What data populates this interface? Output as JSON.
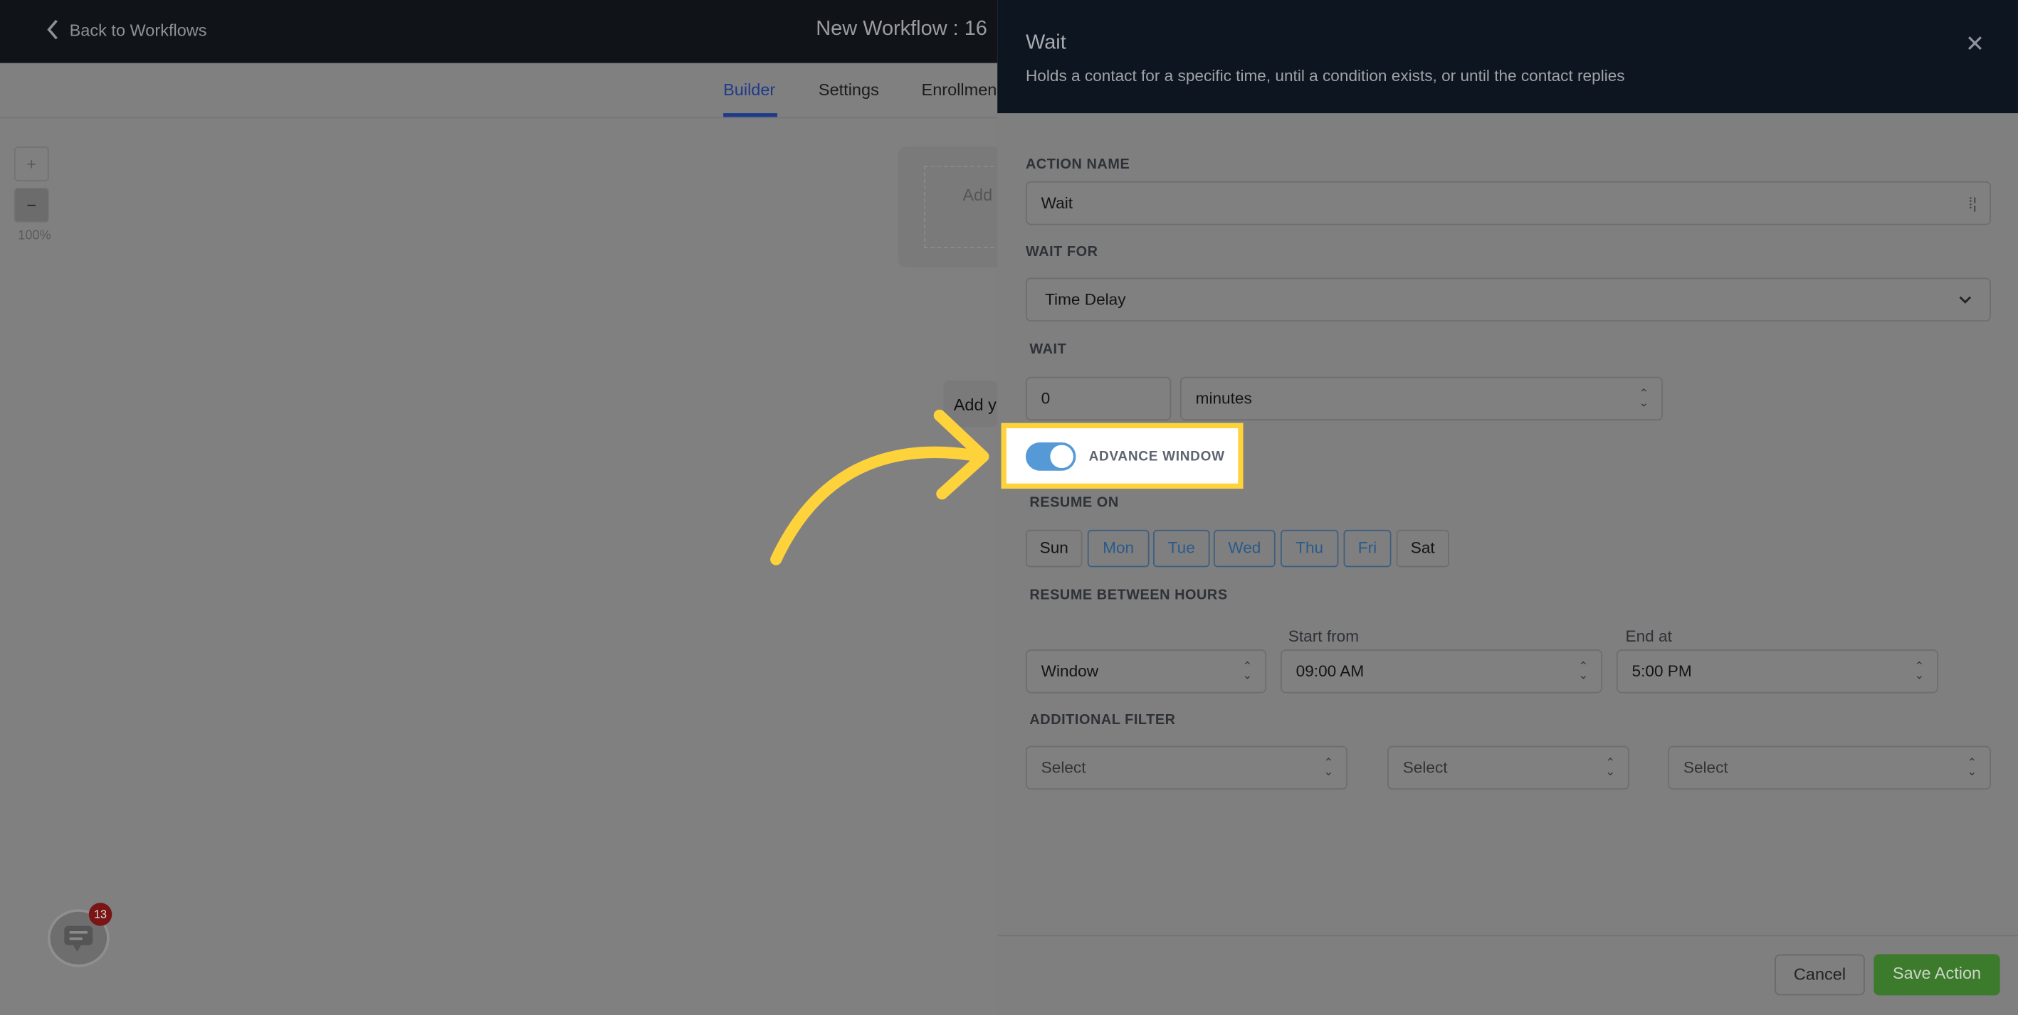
{
  "header": {
    "back_label": "Back to Workflows",
    "workflow_title": "New Workflow : 16"
  },
  "tabs": [
    {
      "label": "Builder",
      "active": true
    },
    {
      "label": "Settings"
    },
    {
      "label": "Enrollmen"
    }
  ],
  "canvas": {
    "zoom_in": "+",
    "zoom_out": "−",
    "zoom_level": "100%",
    "add_trigger_text": "Add",
    "add_action_text": "Add y"
  },
  "panel": {
    "title": "Wait",
    "subtitle": "Holds a contact for a specific time, until a condition exists, or until the contact replies",
    "action_name_label": "ACTION NAME",
    "action_name_value": "Wait",
    "wait_for_label": "WAIT FOR",
    "wait_for_value": "Time Delay",
    "wait_label": "WAIT",
    "wait_amount": "0",
    "wait_unit": "minutes",
    "advance_window_label": "ADVANCE WINDOW",
    "advance_window_on": true,
    "resume_on_label": "RESUME ON",
    "days": [
      {
        "label": "Sun",
        "selected": false
      },
      {
        "label": "Mon",
        "selected": true
      },
      {
        "label": "Tue",
        "selected": true
      },
      {
        "label": "Wed",
        "selected": true
      },
      {
        "label": "Thu",
        "selected": true
      },
      {
        "label": "Fri",
        "selected": true
      },
      {
        "label": "Sat",
        "selected": false
      }
    ],
    "resume_between_label": "RESUME BETWEEN HOURS",
    "window_value": "Window",
    "start_label": "Start from",
    "start_value": "09:00 AM",
    "end_label": "End at",
    "end_value": "5:00 PM",
    "additional_filter_label": "ADDITIONAL FILTER",
    "filters": [
      "Select",
      "Select",
      "Select"
    ],
    "cancel_label": "Cancel",
    "save_label": "Save Action"
  },
  "chat_widget": {
    "badge_count": "13"
  },
  "colors": {
    "accent": "#1f3a8a",
    "toggle": "#5599d6",
    "highlight": "#fdd23b",
    "save": "#3c7a2c"
  }
}
